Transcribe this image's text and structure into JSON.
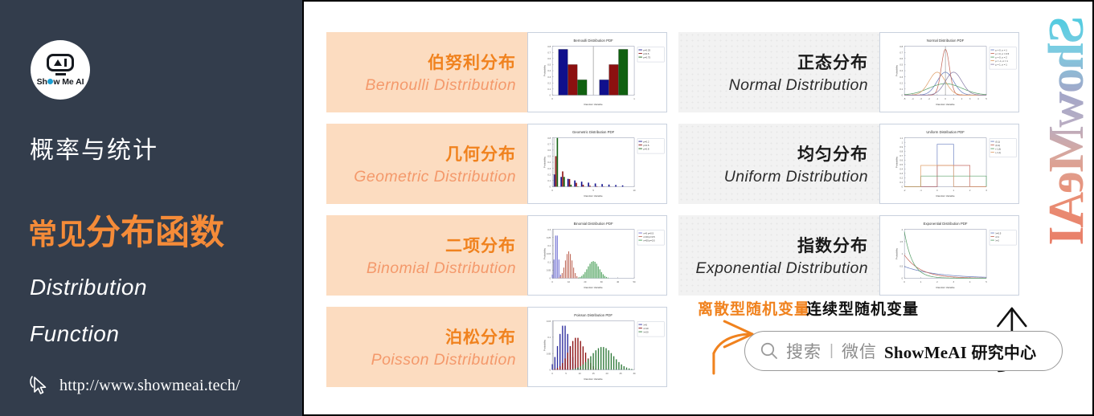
{
  "sidebar": {
    "logo": {
      "icon": "showmeai-robot-logo",
      "text": "Show Me AI"
    },
    "title_cn": "概率与统计",
    "headline_lead": "常见",
    "headline_main": "分布函数",
    "subtitle_en_line1": "Distribution",
    "subtitle_en_line2": "Function",
    "url": "http://www.showmeai.tech/",
    "cursor_icon": "cursor-pointer-icon",
    "bg_color": "#333d4c",
    "accent_color": "#f58b38"
  },
  "content": {
    "watermark": "ShowMeAI",
    "annotations": {
      "discrete": "离散型随机变量",
      "continuous": "连续型随机变量"
    },
    "search": {
      "icon": "search-magnifier-icon",
      "placeholder": "搜索",
      "separator": "|",
      "channel": "微信",
      "brand": "ShowMeAI",
      "brand_cn": "研究中心"
    }
  },
  "cards": {
    "discrete": [
      {
        "cn": "伯努利分布",
        "en": "Bernoulli Distribution",
        "chart": "bernoulli"
      },
      {
        "cn": "几何分布",
        "en": "Geometric Distribution",
        "chart": "geometric"
      },
      {
        "cn": "二项分布",
        "en": "Binomial Distribution",
        "chart": "binomial"
      },
      {
        "cn": "泊松分布",
        "en": "Poisson Distribution",
        "chart": "poisson"
      }
    ],
    "continuous": [
      {
        "cn": "正态分布",
        "en": "Normal Distribution",
        "chart": "normal"
      },
      {
        "cn": "均匀分布",
        "en": "Uniform Distribution",
        "chart": "uniform"
      },
      {
        "cn": "指数分布",
        "en": "Exponential Distribution",
        "chart": "exponential"
      }
    ]
  },
  "chart_data": [
    {
      "id": "bernoulli",
      "type": "bar",
      "title": "Bernoulli Distribution PDF",
      "xlabel": "Random Variable",
      "ylabel": "Probability",
      "categories": [
        "0",
        "1"
      ],
      "xticks": [
        "0",
        "1"
      ],
      "yticks": [
        "0",
        "0.1",
        "0.2",
        "0.3",
        "0.4",
        "0.5",
        "0.6",
        "0.7",
        "0.8"
      ],
      "ylim": [
        0,
        0.8
      ],
      "legend": [
        "p=0.25",
        "p=0.5",
        "p=0.75"
      ],
      "legend_position": "right",
      "colors": [
        "#10108c",
        "#8c1010",
        "#106010"
      ],
      "series": [
        {
          "name": "p=0.25",
          "values": [
            0.75,
            0.25
          ]
        },
        {
          "name": "p=0.5",
          "values": [
            0.5,
            0.5
          ]
        },
        {
          "name": "p=0.75",
          "values": [
            0.25,
            0.75
          ]
        }
      ]
    },
    {
      "id": "geometric",
      "type": "bar",
      "title": "Geometric Distribution PDF",
      "xlabel": "Random Variable",
      "ylabel": "Probability",
      "xticks": [
        "0",
        "5",
        "10"
      ],
      "yticks": [
        "0",
        "0.1",
        "0.2",
        "0.3",
        "0.4",
        "0.5",
        "0.6",
        "0.7",
        "0.8"
      ],
      "ylim": [
        0,
        0.8
      ],
      "legend": [
        "p=0.2",
        "p=0.5",
        "p=0.8"
      ],
      "legend_position": "right",
      "colors": [
        "#10108c",
        "#8c1010",
        "#106010"
      ],
      "x": [
        0,
        1,
        2,
        3,
        4,
        5,
        6,
        7,
        8,
        9,
        10
      ],
      "series": [
        {
          "name": "p=0.2",
          "values": [
            0.2,
            0.16,
            0.128,
            0.102,
            0.082,
            0.066,
            0.052,
            0.042,
            0.034,
            0.027,
            0.021
          ]
        },
        {
          "name": "p=0.5",
          "values": [
            0.5,
            0.25,
            0.125,
            0.063,
            0.031,
            0.016,
            0.008,
            0.004,
            0.002,
            0.001,
            0.0005
          ]
        },
        {
          "name": "p=0.8",
          "values": [
            0.8,
            0.16,
            0.032,
            0.006,
            0.001,
            0.0003,
            0,
            0,
            0,
            0,
            0
          ]
        }
      ]
    },
    {
      "id": "binomial",
      "type": "bar",
      "title": "Binomial Distribution PDF",
      "xlabel": "Random Variable",
      "ylabel": "Probability",
      "xticks": [
        "0",
        "10",
        "20",
        "30",
        "40",
        "50"
      ],
      "yticks": [
        "0",
        "0.05",
        "0.1",
        "0.15",
        "0.2",
        "0.25",
        "0.3"
      ],
      "ylim": [
        0,
        0.32
      ],
      "legend": [
        "n=5 p=0.5",
        "n=20 p=0.5",
        "n=50 p=0.5"
      ],
      "legend_position": "right",
      "colors": [
        "#6a6ad0",
        "#c06a5a",
        "#3f9a4f"
      ],
      "series": [
        {
          "name": "n=5 p=0.5",
          "peak_x": 2.5,
          "peak_y": 0.31,
          "spread": 1.1
        },
        {
          "name": "n=20 p=0.5",
          "peak_x": 10,
          "peak_y": 0.176,
          "spread": 2.2
        },
        {
          "name": "n=50 p=0.5",
          "peak_x": 25,
          "peak_y": 0.112,
          "spread": 3.5
        }
      ]
    },
    {
      "id": "poisson",
      "type": "bar",
      "title": "Poisson Distribution PDF",
      "xlabel": "Random Variable",
      "ylabel": "Probability",
      "xticks": [
        "0",
        "5",
        "10",
        "15",
        "20",
        "25",
        "30"
      ],
      "yticks": [
        "0",
        "0.05",
        "0.1",
        "0.15"
      ],
      "ylim": [
        0,
        0.19
      ],
      "legend": [
        "λ=5",
        "λ=10",
        "λ=20"
      ],
      "legend_position": "right",
      "colors": [
        "#2c2c9e",
        "#8c1010",
        "#2f7a3a"
      ],
      "series": [
        {
          "name": "λ=5",
          "peak_x": 4.5,
          "peak_y": 0.176,
          "spread": 2.2
        },
        {
          "name": "λ=10",
          "peak_x": 9.5,
          "peak_y": 0.126,
          "spread": 3.1
        },
        {
          "name": "λ=20",
          "peak_x": 19.5,
          "peak_y": 0.089,
          "spread": 4.4
        }
      ]
    },
    {
      "id": "normal",
      "type": "line",
      "title": "Normal Distribution PDF",
      "xlabel": "Random Variable",
      "ylabel": "Probability",
      "xticks": [
        "-5",
        "-4",
        "-3",
        "-2",
        "-1",
        "0",
        "1",
        "2",
        "3",
        "4",
        "5"
      ],
      "yticks": [
        "0",
        "0.1",
        "0.2",
        "0.3",
        "0.4",
        "0.5",
        "0.6",
        "0.7",
        "0.8"
      ],
      "ylim": [
        0,
        0.85
      ],
      "legend": [
        "μ = 0, σ = 1",
        "μ = 0, σ = 0.5",
        "μ = 0, σ = 2",
        "μ = -1, σ = 1",
        "μ = 1, σ = 1"
      ],
      "legend_position": "right",
      "colors": [
        "#6a7fc0",
        "#c4695c",
        "#5aa06a",
        "#e0a06a",
        "#8a7fa8"
      ],
      "series": [
        {
          "name": "μ = 0, σ = 1",
          "mu": 0,
          "sigma": 1
        },
        {
          "name": "μ = 0, σ = 0.5",
          "mu": 0,
          "sigma": 0.5
        },
        {
          "name": "μ = 0, σ = 2",
          "mu": 0,
          "sigma": 2
        },
        {
          "name": "μ = -1, σ = 1",
          "mu": -1,
          "sigma": 1
        },
        {
          "name": "μ = 1, σ = 1",
          "mu": 1,
          "sigma": 1
        }
      ]
    },
    {
      "id": "uniform",
      "type": "line",
      "title": "Uniform Distribution PDF",
      "xlabel": "Random Variable",
      "ylabel": "Probability",
      "xticks": [
        "-2",
        "-1",
        "0",
        "1",
        "2",
        "3"
      ],
      "yticks": [
        "0",
        "0.1",
        "0.2",
        "0.3",
        "0.4",
        "0.5",
        "0.6",
        "0.7",
        "0.8",
        "0.9",
        "1",
        "1.1"
      ],
      "ylim": [
        0,
        1.15
      ],
      "legend": [
        "(0,1)",
        "(0,2)",
        "(-1,3)",
        "(-1,1)"
      ],
      "legend_position": "right",
      "colors": [
        "#6a7fc0",
        "#c4695c",
        "#5aa06a",
        "#e0a06a"
      ],
      "series": [
        {
          "name": "(0,1)",
          "a": 0,
          "b": 1,
          "height": 1.0
        },
        {
          "name": "(0,2)",
          "a": 0,
          "b": 2,
          "height": 0.5
        },
        {
          "name": "(-1,3)",
          "a": -1,
          "b": 3,
          "height": 0.25
        },
        {
          "name": "(-1,1)",
          "a": -1,
          "b": 1,
          "height": 0.5
        }
      ]
    },
    {
      "id": "exponential",
      "type": "line",
      "title": "Exponential Distribution PDF",
      "xlabel": "Random Variable",
      "ylabel": "Probability",
      "xticks": [
        "0",
        "1",
        "2",
        "3",
        "4",
        "5"
      ],
      "yticks": [
        "0",
        "0.5",
        "1",
        "1.5",
        "2"
      ],
      "ylim": [
        0,
        2.1
      ],
      "legend": [
        "λ=0.5",
        "λ=1",
        "λ=2"
      ],
      "legend_position": "right",
      "colors": [
        "#6a7fc0",
        "#c4695c",
        "#5aa06a"
      ],
      "series": [
        {
          "name": "λ=0.5",
          "lambda": 0.5
        },
        {
          "name": "λ=1",
          "lambda": 1
        },
        {
          "name": "λ=2",
          "lambda": 2
        }
      ]
    }
  ]
}
